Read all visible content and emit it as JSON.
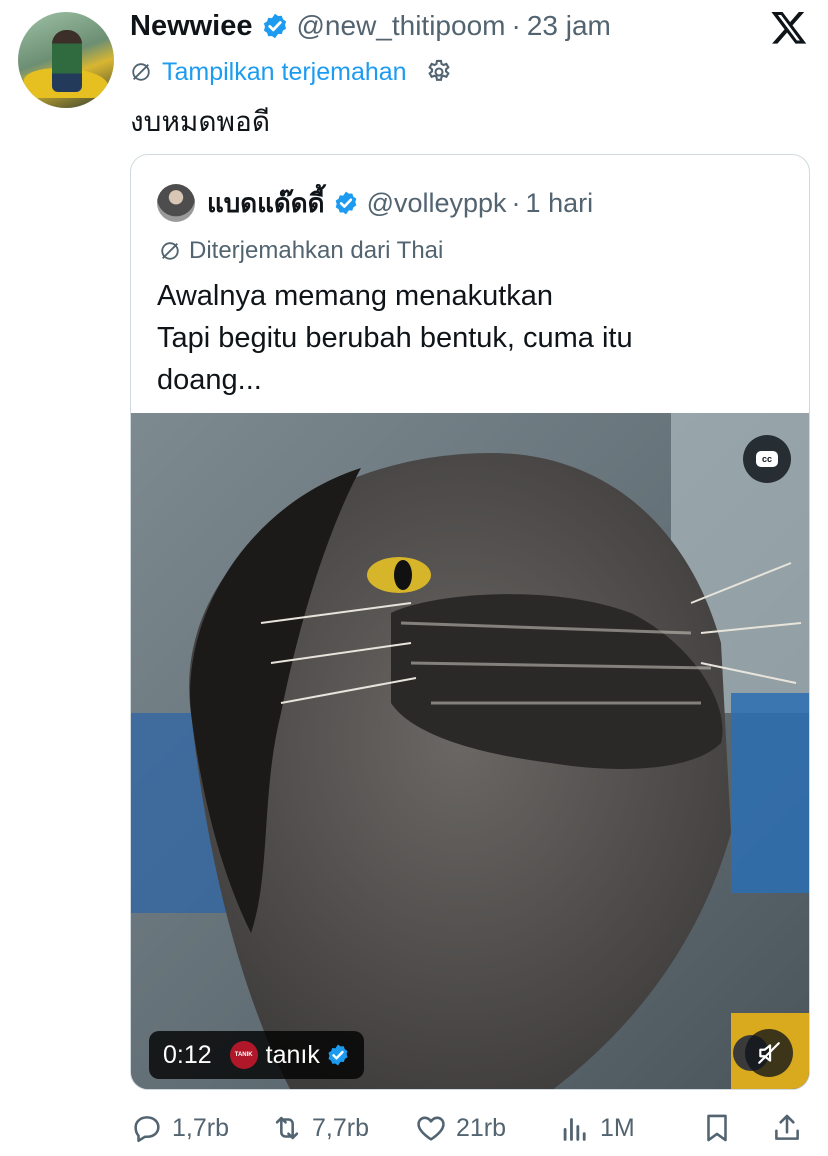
{
  "tweet": {
    "display_name": "Newwiee",
    "handle": "@new_thitipoom",
    "separator": "·",
    "time": "23 jam",
    "translate_link": "Tampilkan terjemahan",
    "text": "งบหมดพอดี"
  },
  "quote": {
    "display_name": "แบดแด๊ดดี้",
    "handle": "@volleyppk",
    "separator": "·",
    "time": "1 hari",
    "translated_label": "Diterjemahkan dari Thai",
    "text_lines": [
      "Awalnya memang menakutkan",
      "Tapi begitu berubah bentuk, cuma itu",
      "doang..."
    ],
    "media": {
      "time": "0:12",
      "source_name": "tanık",
      "source_logo_text": "TANIK",
      "cc_label": "cc"
    }
  },
  "actions": {
    "replies": "1,7rb",
    "reposts": "7,7rb",
    "likes": "21rb",
    "views": "1M"
  },
  "colors": {
    "accent": "#1d9bf0",
    "muted_text": "#536471",
    "border": "#cfd9de"
  },
  "icons": [
    "x-logo-icon",
    "verified-badge-icon",
    "globe-translate-icon",
    "gear-icon",
    "cc-icon",
    "mute-icon",
    "reply-icon",
    "repost-icon",
    "like-icon",
    "views-icon",
    "bookmark-icon",
    "share-icon"
  ]
}
